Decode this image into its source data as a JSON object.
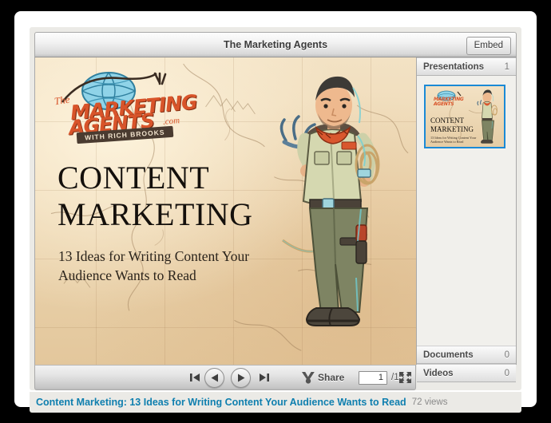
{
  "window": {
    "title": "The Marketing Agents",
    "embed_button": "Embed"
  },
  "slide": {
    "title_line1": "CONTENT",
    "title_line2": "MARKETING",
    "subtitle": "13 Ideas for Writing Content Your Audience Wants to Read",
    "logo": {
      "the": "The",
      "word1": "MARKETING",
      "word2": "AGENTS",
      "com": ".com",
      "banner": "WITH RICH BROOKS"
    },
    "background_color": "#edd7b2",
    "title_color": "#14100c",
    "logo_color": "#d8542a"
  },
  "sidebar": {
    "panels": [
      {
        "label": "Presentations",
        "count": "1"
      },
      {
        "label": "Documents",
        "count": "0"
      },
      {
        "label": "Videos",
        "count": "0"
      }
    ],
    "thumbnail": {
      "title_line1": "CONTENT",
      "title_line2": "MARKETING",
      "subtitle": "13 Ideas for Writing Content Your Audience Wants to Read",
      "logo_word1": "MARKETING",
      "logo_word2": "AGENTS",
      "selected_border_color": "#1b8ad6"
    }
  },
  "controls": {
    "first_icon": "skip-to-start-icon",
    "prev_icon": "previous-icon",
    "next_icon": "next-icon",
    "last_icon": "skip-to-end-icon",
    "share_icon": "share-icon",
    "share_label": "Share",
    "page_value": "1",
    "page_total": "/15",
    "fullscreen_icon": "fullscreen-icon"
  },
  "caption": {
    "link_text": "Content Marketing: 13 Ideas for Writing Content Your Audience Wants to Read",
    "views": "72 views",
    "link_color": "#0f7faf"
  }
}
